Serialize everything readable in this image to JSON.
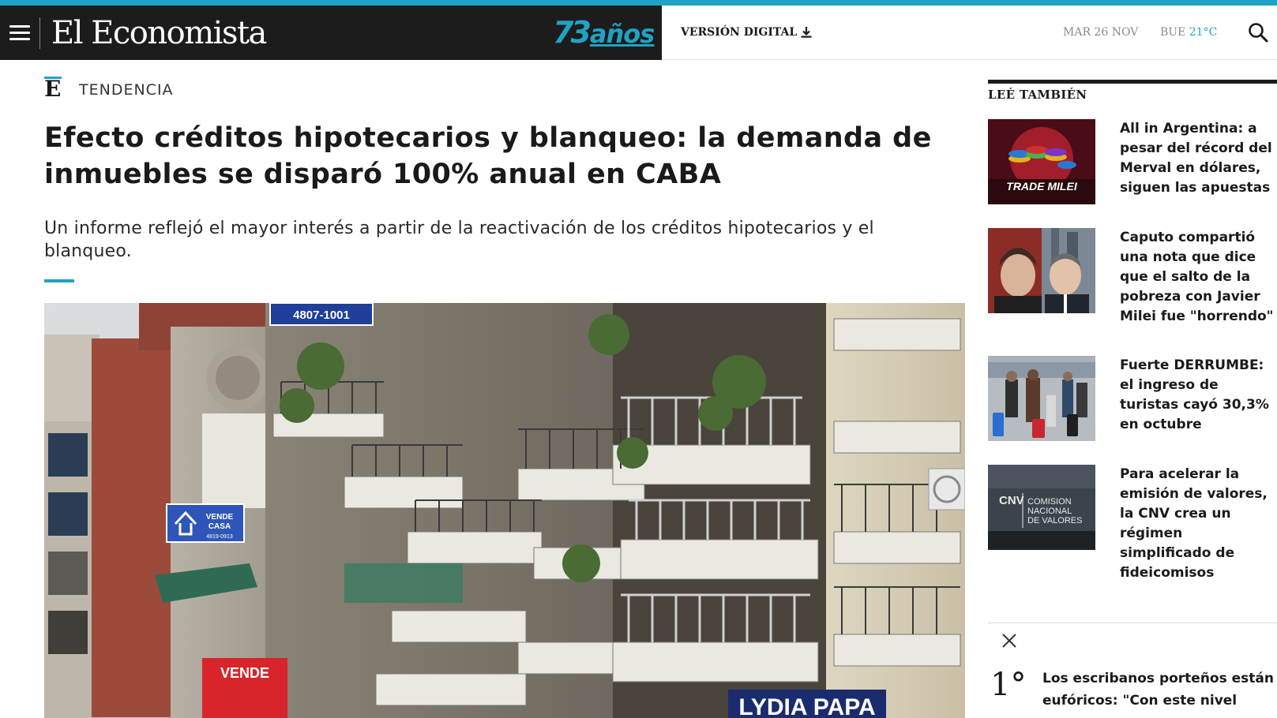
{
  "header": {
    "logo": "El Economista",
    "anniversary_number": "73",
    "anniversary_text": "años",
    "digital_label": "VERSIÓN DIGITAL",
    "date": "MAR 26 NOV",
    "weather_city": "BUE",
    "weather_temp": "21°C",
    "accent_color": "#1fa3c4"
  },
  "article": {
    "kicker": "TENDENCIA",
    "title": "Efecto créditos hipotecarios y blanqueo: la demanda de inmuebles se disparó 100% anual en CABA",
    "subtitle": "Un informe reflejó el mayor interés a partir de la reactivación de los créditos hipotecarios y el blanqueo.",
    "hero_signs": {
      "phone": "4807-1001",
      "vende_casa_1": "VENDE",
      "vende_casa_2": "CASA",
      "vende_casa_phone": "4819-0913",
      "vende": "VENDE",
      "lydia": "LYDIA PAPA"
    }
  },
  "sidebar": {
    "title": "LEÉ TAMBIÉN",
    "items": [
      {
        "title": "All in Argentina: a pesar del récord del Merval en dólares, siguen las apuestas",
        "thumb_label": "TRADE MILEI"
      },
      {
        "title": "Caputo compartió una nota que dice que el salto de la pobreza con Javier Milei fue \"horrendo\""
      },
      {
        "title": "Fuerte DERRUMBE: el ingreso de turistas cayó 30,3% en octubre"
      },
      {
        "title": "Para acelerar la emisión de valores, la CNV crea un régimen simplificado de fideicomisos",
        "thumb_label_1": "CNV",
        "thumb_label_2": "COMISION",
        "thumb_label_3": "NACIONAL",
        "thumb_label_4": "DE VALORES"
      }
    ]
  },
  "trending": {
    "rank": "1°",
    "title": "Los escribanos porteños están eufóricos: \"Con este nivel"
  }
}
